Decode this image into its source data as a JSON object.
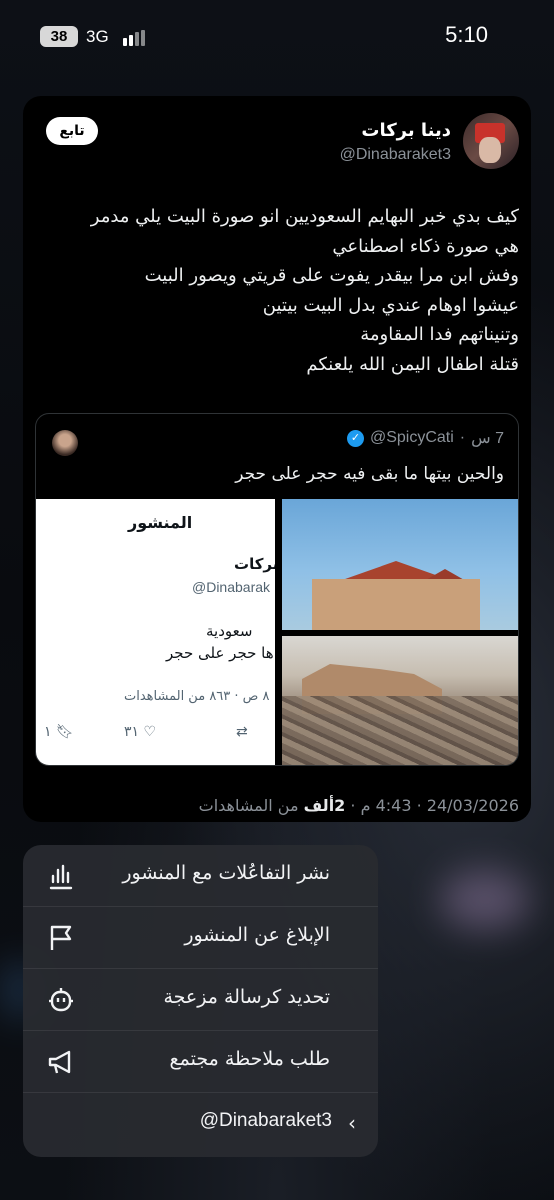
{
  "status_bar": {
    "battery": "38",
    "network": "3G",
    "time": "5:10"
  },
  "post": {
    "author_name": "دينا بركات",
    "author_handle": "@Dinabaraket3",
    "follow_label": "تابع",
    "text_lines": [
      "كيف بدي خبر البهايم السعوديين انو صورة البيت يلي مدمر",
      "هي صورة ذكاء اصطناعي",
      "وفش ابن مرا بيقدر يفوت على قريتي ويصور البيت",
      "عيشوا اوهام عندي بدل البيت بيتين",
      "وتنيناتهم فدا المقاومة",
      "قتلة اطفال اليمن الله يلعنكم"
    ],
    "quoted": {
      "handle": "@SpicyCati",
      "time_ago": "7 س",
      "text": "والحين بيتها ما بقى فيه حجر على حجر",
      "screenshot": {
        "title": "المنشور",
        "name": "بركات",
        "handle": "@Dinabarak",
        "line1": "سعودية",
        "line2": "ها حجر على حجر",
        "meta": "٨ ص · ٨٦٣ من المشاهدات",
        "likes": "٣١",
        "bookmarks": "١"
      }
    },
    "meta": {
      "date": "24/03/2026",
      "time": "4:43 م",
      "views_count": "2ألف",
      "views_label": "من المشاهدات"
    }
  },
  "menu": {
    "items": [
      {
        "label": "نشر التفاعُلات مع المنشور",
        "icon": "bar-chart-icon"
      },
      {
        "label": "الإبلاغ عن المنشور",
        "icon": "flag-icon"
      },
      {
        "label": "تحديد كرسالة مزعجة",
        "icon": "robot-icon"
      },
      {
        "label": "طلب ملاحظة مجتمع",
        "icon": "megaphone-icon"
      }
    ],
    "profile_label": "@Dinabaraket3"
  }
}
